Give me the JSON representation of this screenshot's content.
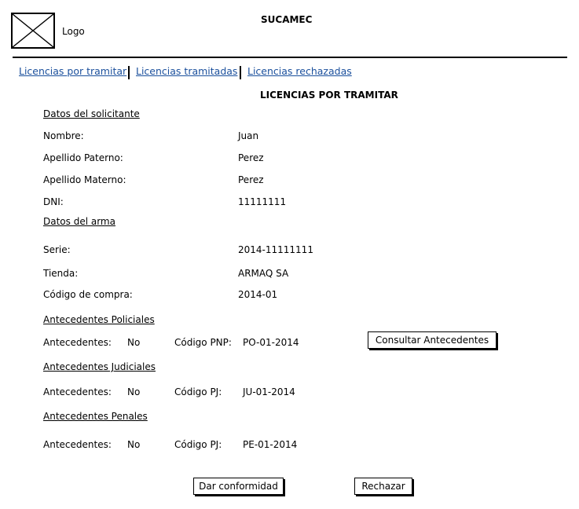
{
  "header": {
    "logo_label": "Logo",
    "app_title": "SUCAMEC"
  },
  "nav": {
    "tab1": "Licencias por tramitar",
    "tab2": "Licencias tramitadas",
    "tab3": "Licencias rechazadas"
  },
  "page": {
    "title": "LICENCIAS POR TRAMITAR"
  },
  "solicitante": {
    "section_title": "Datos del solicitante",
    "nombre_label": "Nombre:",
    "nombre_value": "Juan",
    "apellido_paterno_label": "Apellido Paterno:",
    "apellido_paterno_value": "Perez",
    "apellido_materno_label": "Apellido Materno:",
    "apellido_materno_value": "Perez",
    "dni_label": "DNI:",
    "dni_value": "11111111"
  },
  "arma": {
    "section_title": "Datos del arma",
    "serie_label": "Serie:",
    "serie_value": "2014-11111111",
    "tienda_label": "Tienda:",
    "tienda_value": "ARMAQ SA",
    "codigo_compra_label": "Código de compra:",
    "codigo_compra_value": "2014-01"
  },
  "policiales": {
    "section_title": "Antecedentes Policiales",
    "antecedentes_label": "Antecedentes:",
    "antecedentes_value": "No",
    "codigo_label": "Código PNP:",
    "codigo_value": "PO-01-2014",
    "consultar_button": "Consultar Antecedentes"
  },
  "judiciales": {
    "section_title": "Antecedentes Judiciales",
    "antecedentes_label": "Antecedentes:",
    "antecedentes_value": "No",
    "codigo_label": "Código PJ:",
    "codigo_value": "JU-01-2014"
  },
  "penales": {
    "section_title": "Antecedentes Penales",
    "antecedentes_label": "Antecedentes:",
    "antecedentes_value": "No",
    "codigo_label": "Código PJ:",
    "codigo_value": "PE-01-2014"
  },
  "actions": {
    "confirm_button": "Dar conformidad",
    "reject_button": "Rechazar"
  },
  "colors": {
    "link": "#1a4f9c"
  }
}
